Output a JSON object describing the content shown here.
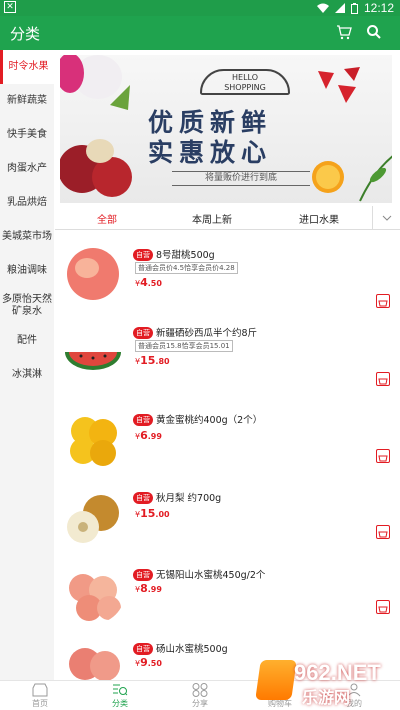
{
  "status": {
    "time": "12:12"
  },
  "header": {
    "title": "分类"
  },
  "sidebar": {
    "items": [
      {
        "label": "时令水果"
      },
      {
        "label": "新鲜蔬菜"
      },
      {
        "label": "快手美食"
      },
      {
        "label": "肉蛋水产"
      },
      {
        "label": "乳品烘焙"
      },
      {
        "label": "美城菜市场"
      },
      {
        "label": "粮油调味"
      },
      {
        "label": "多原怡天然矿泉水"
      },
      {
        "label": "配件"
      },
      {
        "label": "冰淇淋"
      }
    ]
  },
  "banner": {
    "hello": "HELLO",
    "shopping": "SHOPPING",
    "line1": "优质新鲜",
    "line2": "实惠放心",
    "slogan": "将量贩价进行到底"
  },
  "tabs": {
    "all": "全部",
    "new": "本周上新",
    "imported": "进口水果"
  },
  "products": [
    {
      "badge": "自营",
      "name": "8号甜桃500g",
      "member": "普通会员价4.5恰享会员价4.28",
      "yen": "¥",
      "int": "4",
      "cents": ".50"
    },
    {
      "badge": "自营",
      "name": "新疆硒砂西瓜半个约8斤",
      "member": "普通会员15.8恰享会员15.01",
      "yen": "¥",
      "int": "15",
      "cents": ".80"
    },
    {
      "badge": "自营",
      "name": "黄金蜜桃约400g（2个）",
      "member": "",
      "yen": "¥",
      "int": "6",
      "cents": ".99"
    },
    {
      "badge": "自营",
      "name": "秋月梨 约700g",
      "member": "",
      "yen": "¥",
      "int": "15",
      "cents": ".00"
    },
    {
      "badge": "自营",
      "name": "无锡阳山水蜜桃450g/2个",
      "member": "",
      "yen": "¥",
      "int": "8",
      "cents": ".99"
    },
    {
      "badge": "自营",
      "name": "砀山水蜜桃500g",
      "member": "",
      "yen": "¥",
      "int": "9",
      "cents": ".50"
    }
  ],
  "tabbar": {
    "home": "首页",
    "category": "分类",
    "share": "分享",
    "cart": "购物车",
    "mine": "我的"
  },
  "watermark": {
    "num": "962",
    "net": ".NET",
    "cn": "乐游网"
  },
  "colors": {
    "primary": "#1fa34e",
    "accent": "#e21c23"
  }
}
